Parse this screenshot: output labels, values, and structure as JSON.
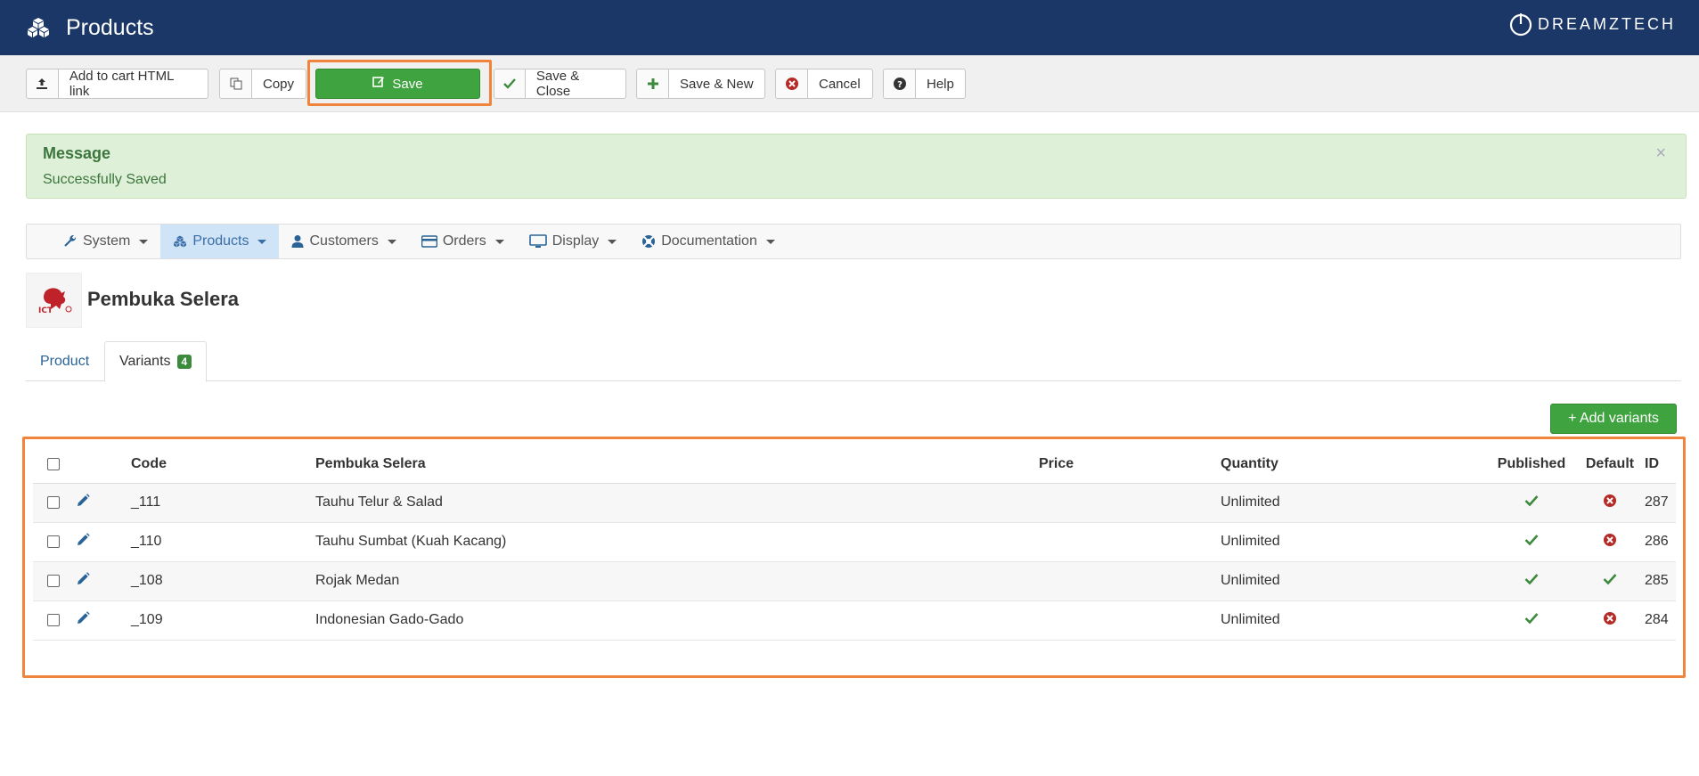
{
  "header": {
    "title": "Products",
    "brand": "DREAMZTECH"
  },
  "toolbar": {
    "add_to_cart": "Add to cart HTML link",
    "copy": "Copy",
    "save": "Save",
    "save_close": "Save & Close",
    "save_new": "Save & New",
    "cancel": "Cancel",
    "help": "Help"
  },
  "message": {
    "heading": "Message",
    "text": "Successfully Saved",
    "close": "×"
  },
  "nav": [
    "System",
    "Products",
    "Customers",
    "Orders",
    "Display",
    "Documentation"
  ],
  "product": {
    "name": "Pembuka Selera"
  },
  "tabs": {
    "product": "Product",
    "variants": "Variants",
    "variants_count": "4"
  },
  "add_variants": "+ Add variants",
  "table": {
    "headers": {
      "code": "Code",
      "name": "Pembuka Selera",
      "price": "Price",
      "quantity": "Quantity",
      "published": "Published",
      "default": "Default",
      "id": "ID"
    },
    "rows": [
      {
        "code": "_111",
        "name": "Tauhu Telur & Salad",
        "price": "",
        "quantity": "Unlimited",
        "published": true,
        "default": false,
        "id": "287"
      },
      {
        "code": "_110",
        "name": "Tauhu Sumbat (Kuah Kacang)",
        "price": "",
        "quantity": "Unlimited",
        "published": true,
        "default": false,
        "id": "286"
      },
      {
        "code": "_108",
        "name": "Rojak Medan",
        "price": "",
        "quantity": "Unlimited",
        "published": true,
        "default": true,
        "id": "285"
      },
      {
        "code": "_109",
        "name": "Indonesian Gado-Gado",
        "price": "",
        "quantity": "Unlimited",
        "published": true,
        "default": false,
        "id": "284"
      }
    ]
  },
  "colors": {
    "header_bg": "#1b3767",
    "save_green": "#3fa33f",
    "highlight_orange": "#f0843c",
    "success_bg": "#dff0d8"
  }
}
